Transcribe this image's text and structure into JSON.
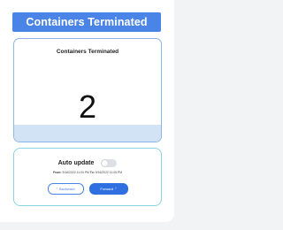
{
  "header": {
    "title": "Containers Terminated"
  },
  "metric": {
    "title": "Containers Terminated",
    "value": "2"
  },
  "controls": {
    "auto_update_label": "Auto update",
    "auto_update_on": false,
    "from_label": "From:",
    "from_value": "9/16/2022 11:04 PM",
    "to_label": "To:",
    "to_value": "9/16/2022 11:05 PM",
    "backward_label": "Backward",
    "forward_label": "Forward",
    "backward_icon": "chevron-left-icon",
    "forward_icon": "chevron-right-icon"
  },
  "colors": {
    "accent": "#4a84e6",
    "button_primary": "#2f6fe0",
    "card_border": "#8ab6e8",
    "control_border": "#8bd3e2",
    "footer_band": "#d3e3f6"
  }
}
